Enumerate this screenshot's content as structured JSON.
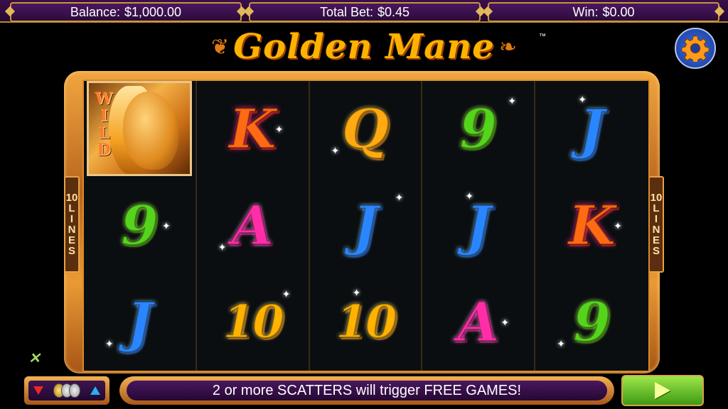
{
  "topbar": {
    "balance_label": "Balance:",
    "balance_value": "$1,000.00",
    "bet_label": "Total Bet:",
    "bet_value": "$0.45",
    "win_label": "Win:",
    "win_value": "$0.00"
  },
  "title": {
    "text": "Golden Mane",
    "trademark": "™"
  },
  "lines_label": [
    "10",
    "L",
    "I",
    "N",
    "E",
    "S"
  ],
  "wild": {
    "letters": [
      "W",
      "I",
      "L",
      "D"
    ]
  },
  "reels": [
    [
      {
        "sym": "WILD",
        "cls": "wild"
      },
      {
        "sym": "9",
        "cls": "n9"
      },
      {
        "sym": "J",
        "cls": "J"
      }
    ],
    [
      {
        "sym": "K",
        "cls": "K"
      },
      {
        "sym": "A",
        "cls": "A"
      },
      {
        "sym": "10",
        "cls": "T ten"
      }
    ],
    [
      {
        "sym": "Q",
        "cls": "Q"
      },
      {
        "sym": "J",
        "cls": "J"
      },
      {
        "sym": "10",
        "cls": "T ten"
      }
    ],
    [
      {
        "sym": "9",
        "cls": "n9"
      },
      {
        "sym": "J",
        "cls": "J"
      },
      {
        "sym": "A",
        "cls": "A"
      }
    ],
    [
      {
        "sym": "J",
        "cls": "J"
      },
      {
        "sym": "K",
        "cls": "K"
      },
      {
        "sym": "9",
        "cls": "n9"
      }
    ]
  ],
  "message": "2 or more SCATTERS will trigger FREE GAMES!",
  "colors": {
    "accent_gold": "#c9963a",
    "panel_purple": "#3a0f4a",
    "spin_green": "#5cbd22"
  }
}
